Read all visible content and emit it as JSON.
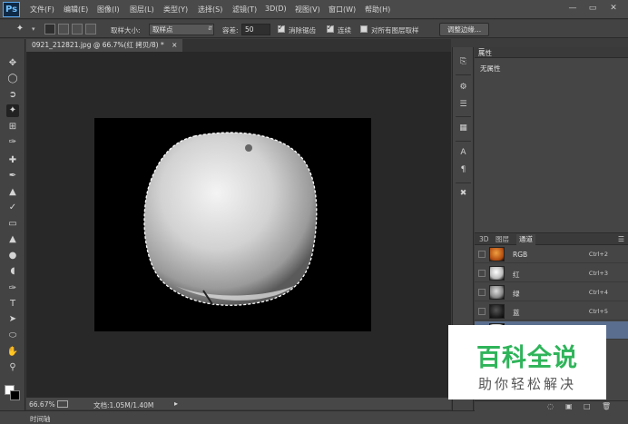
{
  "app": {
    "logo": "Ps"
  },
  "menu": [
    {
      "label": "文件(F)"
    },
    {
      "label": "编辑(E)"
    },
    {
      "label": "图像(I)"
    },
    {
      "label": "图层(L)"
    },
    {
      "label": "类型(Y)"
    },
    {
      "label": "选择(S)"
    },
    {
      "label": "滤镜(T)"
    },
    {
      "label": "3D(D)"
    },
    {
      "label": "视图(V)"
    },
    {
      "label": "窗口(W)"
    },
    {
      "label": "帮助(H)"
    }
  ],
  "window_controls": {
    "minimize": "—",
    "restore": "▭",
    "close": "✕"
  },
  "options": {
    "sample_size_label": "取样大小:",
    "sample_size_value": "取样点",
    "tolerance_label": "容差:",
    "tolerance_value": "50",
    "antialias_label": "消除锯齿",
    "antialias_checked": true,
    "contiguous_label": "连续",
    "contiguous_checked": true,
    "sample_all_layers_label": "对所有图层取样",
    "sample_all_layers_checked": false,
    "refine_edge_label": "调整边缘..."
  },
  "document": {
    "tab_title": "0921_212821.jpg @ 66.7%(红 拷贝/8) *",
    "tab_close": "×"
  },
  "status": {
    "zoom": "66.67%",
    "doc_info": "文档:1.05M/1.40M",
    "timeline_label": "时间轴"
  },
  "properties_panel": {
    "tab": "属性",
    "content": "无属性"
  },
  "channels_panel": {
    "tabs": [
      "3D",
      "图层",
      "通道"
    ],
    "active_tab": "通道",
    "channels": [
      {
        "name": "RGB",
        "shortcut": "Ctrl+2"
      },
      {
        "name": "红",
        "shortcut": "Ctrl+3"
      },
      {
        "name": "绿",
        "shortcut": "Ctrl+4"
      },
      {
        "name": "蓝",
        "shortcut": "Ctrl+5"
      },
      {
        "name": "",
        "shortcut": ""
      }
    ]
  },
  "watermark": {
    "title": "百科全说",
    "subtitle": "助你轻松解决"
  },
  "colors": {
    "panel_bg": "#454545",
    "canvas_bg": "#282828",
    "selected_row": "#5a6f8f",
    "watermark_green": "#2fb45a"
  }
}
